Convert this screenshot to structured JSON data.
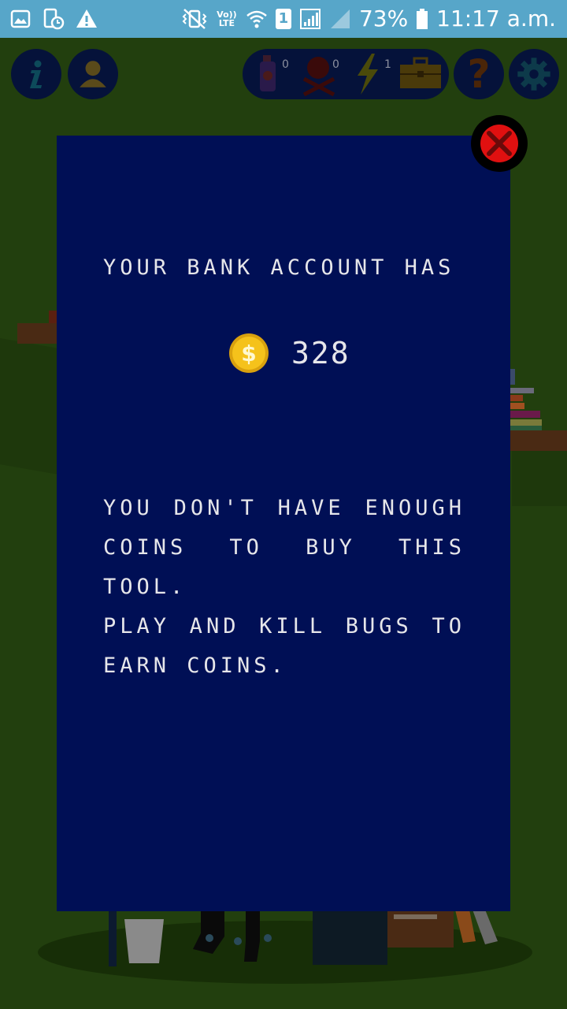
{
  "status_bar": {
    "network": "Vo)) LTE",
    "sim": "1",
    "battery": "73%",
    "time": "11:17 a.m."
  },
  "toolbar": {
    "info_icon": "info-icon",
    "profile_icon": "profile-icon",
    "help_icon": "question-icon",
    "settings_icon": "gear-icon",
    "tools": [
      {
        "name": "bug-spray",
        "count": "0"
      },
      {
        "name": "skull-crossbones",
        "count": "0"
      },
      {
        "name": "lightning",
        "count": "1"
      },
      {
        "name": "toolbox",
        "count": ""
      }
    ]
  },
  "modal": {
    "heading": "YOUR BANK ACCOUNT HAS",
    "coins": "328",
    "message": "YOU DON'T HAVE ENOUGH COINS TO BUY THIS TOOL.",
    "hint": "PLAY AND KILL BUGS TO EARN COINS."
  },
  "colors": {
    "status_bar": "#57a6c9",
    "background": "#223f0e",
    "modal": "#000f55",
    "button_bg": "#05123a",
    "close_red": "#e01010",
    "coin_gold": "#f5c21b"
  }
}
